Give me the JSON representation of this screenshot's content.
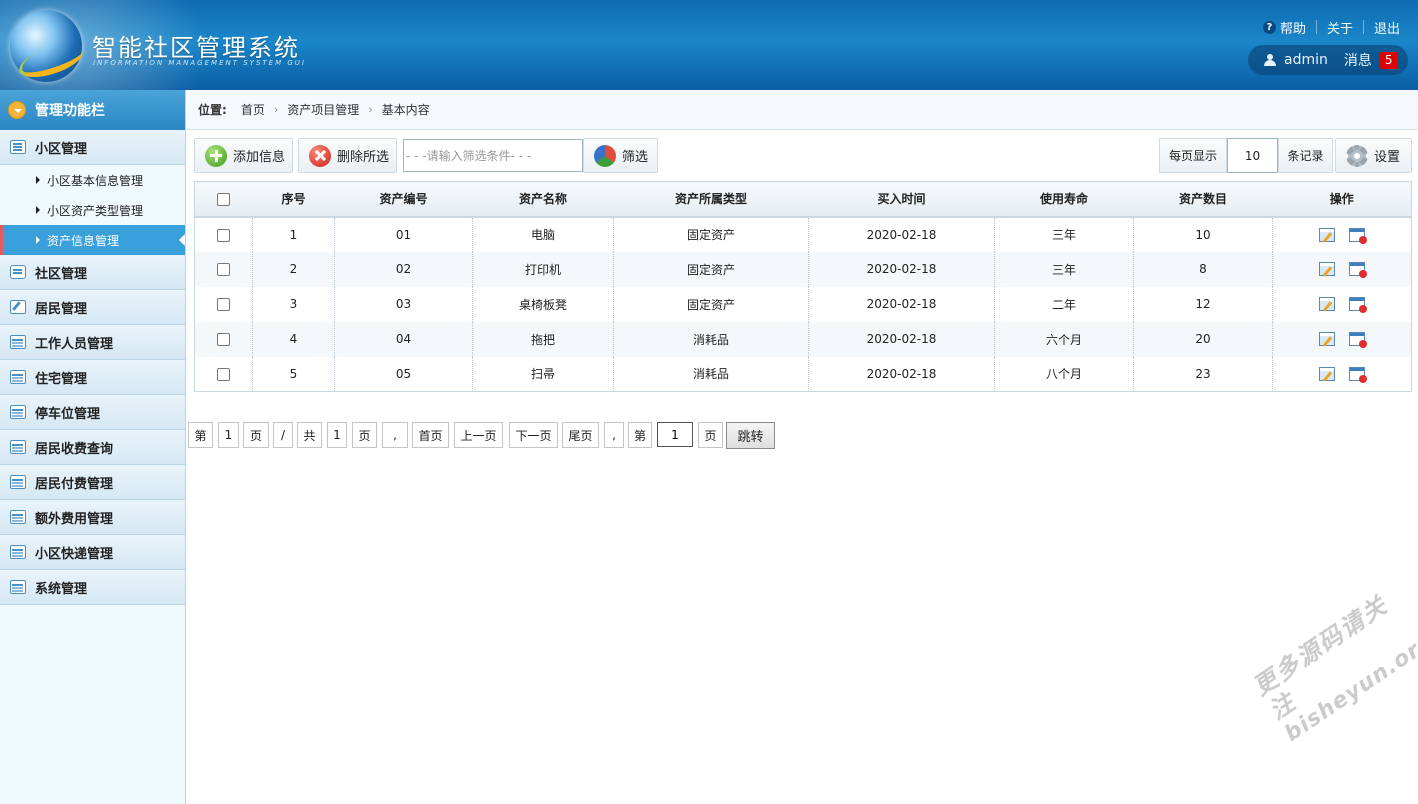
{
  "header": {
    "title": "智能社区管理系统",
    "subtitle": "INFORMATION MANAGEMENT SYSTEM GUI",
    "links": {
      "help": "帮助",
      "about": "关于",
      "logout": "退出"
    },
    "user": "admin",
    "message_label": "消息",
    "message_count": "5"
  },
  "sidebar": {
    "title": "管理功能栏",
    "group_main": "小区管理",
    "sub_items": [
      "小区基本信息管理",
      "小区资产类型管理",
      "资产信息管理"
    ],
    "active_sub": "资产信息管理",
    "items": [
      "社区管理",
      "居民管理",
      "工作人员管理",
      "住宅管理",
      "停车位管理",
      "居民收费查询",
      "居民付费管理",
      "额外费用管理",
      "小区快递管理",
      "系统管理"
    ]
  },
  "breadcrumb": {
    "label": "位置:",
    "crumbs": [
      "首页",
      "资产项目管理",
      "基本内容"
    ]
  },
  "toolbar": {
    "add": "添加信息",
    "delete": "删除所选",
    "filter_placeholder": "- - -请输入筛选条件- - -",
    "filter": "筛选",
    "per_page_label": "每页显示",
    "per_page_value": "10",
    "records_label": "条记录",
    "settings": "设置"
  },
  "table": {
    "columns": [
      "序号",
      "资产编号",
      "资产名称",
      "资产所属类型",
      "买入时间",
      "使用寿命",
      "资产数目",
      "操作"
    ],
    "rows": [
      [
        "1",
        "01",
        "电脑",
        "固定资产",
        "2020-02-18",
        "三年",
        "10"
      ],
      [
        "2",
        "02",
        "打印机",
        "固定资产",
        "2020-02-18",
        "三年",
        "8"
      ],
      [
        "3",
        "03",
        "桌椅板凳",
        "固定资产",
        "2020-02-18",
        "二年",
        "12"
      ],
      [
        "4",
        "04",
        "拖把",
        "消耗品",
        "2020-02-18",
        "六个月",
        "20"
      ],
      [
        "5",
        "05",
        "扫帚",
        "消耗品",
        "2020-02-18",
        "八个月",
        "23"
      ]
    ]
  },
  "pagination": {
    "cells": [
      "第",
      "1",
      "页",
      "/",
      "共",
      "1",
      "页",
      ",",
      "首页",
      "上一页",
      "下一页",
      "尾页",
      ",",
      "第"
    ],
    "jump_value": "1",
    "page_suffix": "页",
    "jump_button": "跳转"
  },
  "watermark": {
    "line1": "更多源码请关注",
    "line2": "bisheyun.org"
  }
}
